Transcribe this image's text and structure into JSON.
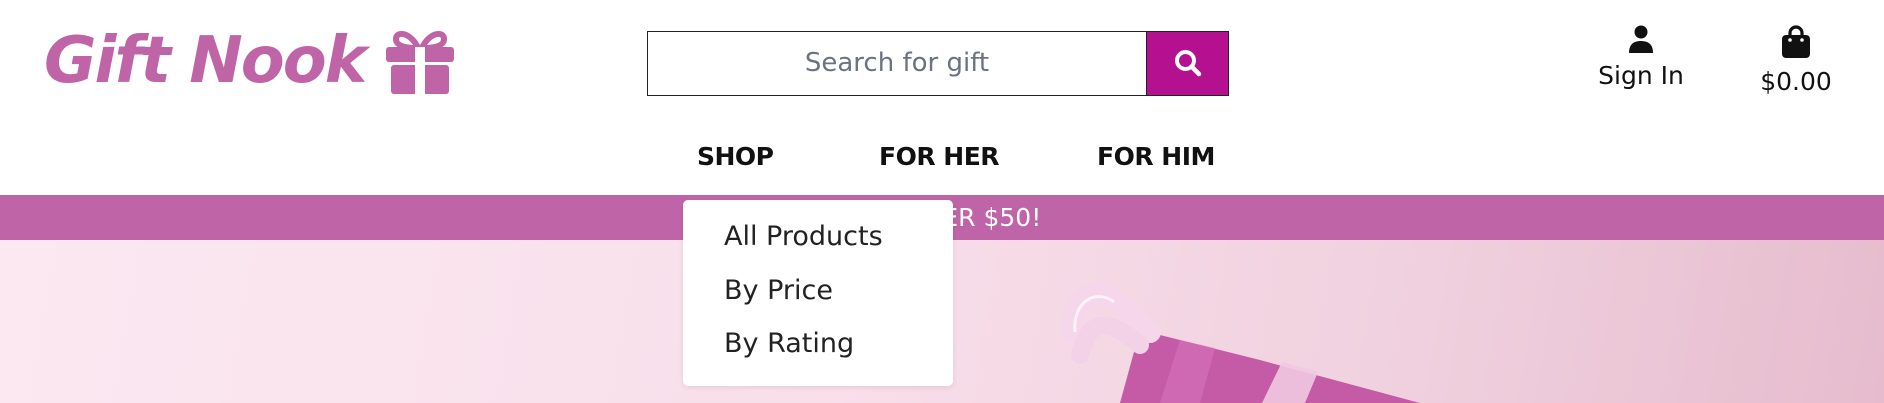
{
  "header": {
    "logo_text": "Gift Nook",
    "logo_icon": "gift-icon",
    "search": {
      "placeholder": "Search for gift",
      "value": "",
      "button_icon": "search-icon"
    },
    "account": {
      "icon": "user-icon",
      "label": "Sign In"
    },
    "cart": {
      "icon": "shopping-bag-icon",
      "total": "$0.00"
    }
  },
  "nav": {
    "items": [
      {
        "label": "SHOP"
      },
      {
        "label": "FOR HER"
      },
      {
        "label": "FOR HIM"
      }
    ]
  },
  "dropdown": {
    "items": [
      {
        "label": "All Products"
      },
      {
        "label": "By Price"
      },
      {
        "label": "By Rating"
      }
    ]
  },
  "promo": {
    "text": "ORDERS OVER $50!"
  },
  "colors": {
    "brand": "#c064a8",
    "search_button": "#b5108f",
    "hero_background": "#f8dfea",
    "ribbon": "#f3d4e6"
  }
}
